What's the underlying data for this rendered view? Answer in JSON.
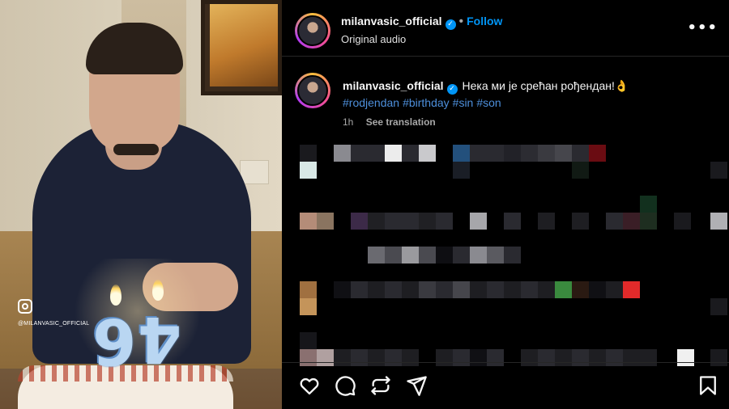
{
  "media": {
    "watermark_text": "@MILANVASIC_OFFICIAL",
    "candle_digit_1": "6",
    "candle_digit_2": "4"
  },
  "header": {
    "username": "milanvasic_official",
    "verified": true,
    "separator": "•",
    "follow_label": "Follow",
    "audio_label": "Original audio",
    "more_label": "•••"
  },
  "caption": {
    "username": "milanvasic_official",
    "text": "Нека ми је срећан рођендан!👌",
    "hashtags": [
      "#rodjendan",
      "#birthday",
      "#sin",
      "#son"
    ],
    "time_ago": "1h",
    "see_translation_label": "See translation"
  },
  "colors": {
    "accent": "#0095f6",
    "background": "#000000",
    "hashtag": "#4d8fdb",
    "secondary_text": "#a8a8a8"
  },
  "actions": [
    "heart-icon",
    "comment-icon",
    "repost-icon",
    "share-icon",
    "bookmark-icon"
  ]
}
